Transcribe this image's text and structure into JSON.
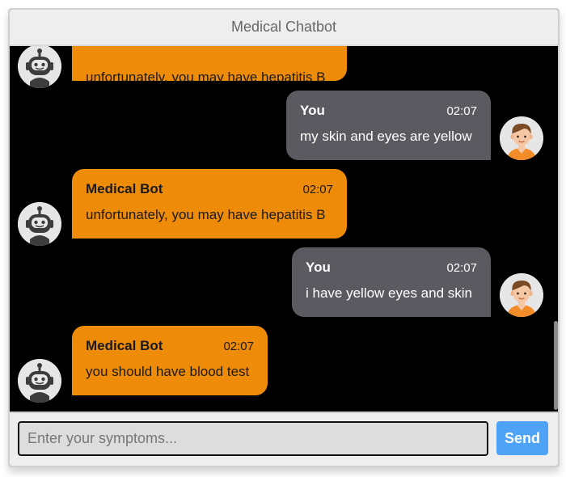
{
  "app": {
    "title": "Medical Chatbot"
  },
  "messages": [
    {
      "sender": "bot",
      "name": "",
      "time": "",
      "text": "unfortunately, you may have hepatitis B"
    },
    {
      "sender": "user",
      "name": "You",
      "time": "02:07",
      "text": "my skin and eyes are yellow"
    },
    {
      "sender": "bot",
      "name": "Medical Bot",
      "time": "02:07",
      "text": "unfortunately, you may have hepatitis B"
    },
    {
      "sender": "user",
      "name": "You",
      "time": "02:07",
      "text": "i have yellow eyes and skin"
    },
    {
      "sender": "bot",
      "name": "Medical Bot",
      "time": "02:07",
      "text": "you should have blood test"
    }
  ],
  "composer": {
    "placeholder": "Enter your symptoms...",
    "value": "",
    "send_label": "Send"
  },
  "colors": {
    "bot_bubble": "#ee8c0a",
    "user_bubble": "#5b5a61",
    "send_button": "#4fa3f7",
    "chat_background": "#000000"
  },
  "icons": {
    "bot_avatar": "robot-icon",
    "user_avatar": "person-icon"
  }
}
